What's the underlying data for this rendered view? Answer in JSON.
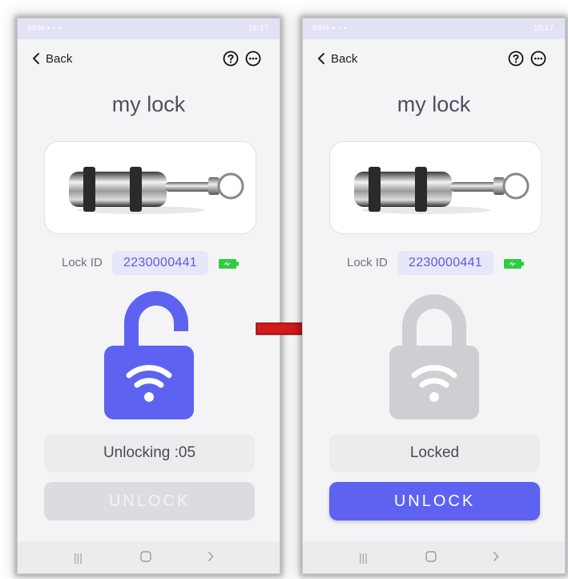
{
  "screens": [
    {
      "status": {
        "left": "66% ▪ ▫ ▪",
        "time": "16:17"
      },
      "nav": {
        "back_label": "Back"
      },
      "title": "my lock",
      "lock_id_label": "Lock ID",
      "lock_id_value": "2230000441",
      "lock_state": "unlocked",
      "lock_color": "#5d63f0",
      "status_text": "Unlocking :05",
      "button_label": "UNLOCK",
      "button_enabled": false
    },
    {
      "status": {
        "left": "66% ▪ ▫ ▪",
        "time": "16:17"
      },
      "nav": {
        "back_label": "Back"
      },
      "title": "my lock",
      "lock_id_label": "Lock ID",
      "lock_id_value": "2230000441",
      "lock_state": "locked",
      "lock_color": "#cfcfd3",
      "status_text": "Locked",
      "button_label": "UNLOCK",
      "button_enabled": true
    }
  ],
  "icons": {
    "back": "chevron-left-icon",
    "help": "question-circle-icon",
    "more": "ellipsis-circle-icon",
    "battery": "battery-charging-icon",
    "wifi": "wifi-icon",
    "recents": "recents-icon",
    "home": "home-icon",
    "nav_back": "chevron-right-icon",
    "transition_arrow": "red-arrow-icon"
  },
  "colors": {
    "accent": "#5d63f0",
    "battery": "#2ecc40",
    "arrow": "#d41a1a"
  }
}
